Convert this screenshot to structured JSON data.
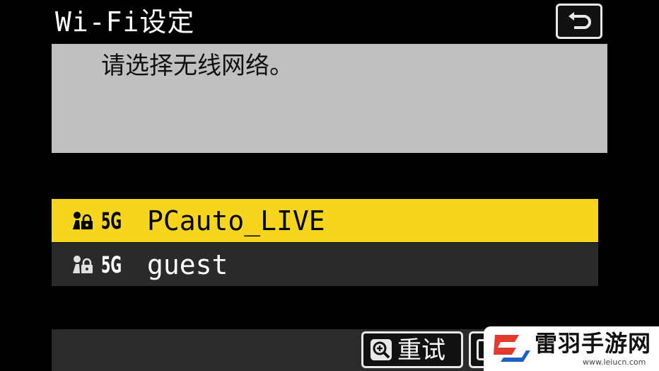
{
  "header": {
    "title": "Wi-Fi设定",
    "back_icon": "return-arrow-icon"
  },
  "message": {
    "text": "请选择无线网络。"
  },
  "networks": [
    {
      "security_icon": "secured-network-icon",
      "band": "5G",
      "ssid": "PCauto_LIVE",
      "selected": true
    },
    {
      "security_icon": "secured-network-icon",
      "band": "5G",
      "ssid": "guest",
      "selected": false
    }
  ],
  "footer": {
    "retry_icon": "zoom-in-icon",
    "retry_label": "重试"
  },
  "watermark": {
    "name": "雷羽手游网",
    "url": "www.leiucn.com"
  },
  "colors": {
    "background": "#000000",
    "panel_gray": "#c0c0c0",
    "selected_row": "#f6d51e",
    "unselected_row": "#2a2a2a",
    "watermark_red": "#e23b2e",
    "watermark_blue": "#1f5fc8"
  }
}
